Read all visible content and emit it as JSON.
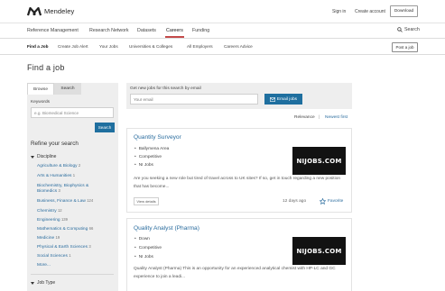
{
  "header": {
    "brand": "Mendeley",
    "sign_in": "Sign in",
    "create_account": "Create account",
    "download": "Download"
  },
  "nav_primary": {
    "items": [
      "Reference Management",
      "Research Network",
      "Datasets",
      "Careers",
      "Funding"
    ],
    "active": "Careers",
    "search": "Search"
  },
  "nav_secondary": {
    "items": [
      "Find a Job",
      "Create Job Alert",
      "Your Jobs",
      "Universities & Colleges",
      "All Employers",
      "Careers Advice"
    ],
    "active": "Find a Job",
    "post_job": "Post a job"
  },
  "page": {
    "title": "Find a job"
  },
  "left_panel": {
    "tabs": [
      "Browse",
      "Search"
    ],
    "keywords_label": "Keywords",
    "keywords_placeholder": "e.g. Biomedical Science",
    "search_button": "Search",
    "refine_title": "Refine your search",
    "discipline_label": "Discipline",
    "disciplines": [
      {
        "label": "Agriculture & Biology",
        "count": "2"
      },
      {
        "label": "Arts & Humanities",
        "count": "1"
      },
      {
        "label": "Biochemistry, Biophysics &",
        "count": ""
      },
      {
        "label": "Biomedics",
        "count": "3"
      },
      {
        "label": "Business, Finance & Law",
        "count": "124"
      },
      {
        "label": "Chemistry",
        "count": "12"
      },
      {
        "label": "Engineering",
        "count": "139"
      },
      {
        "label": "Mathematics & Computing",
        "count": "66"
      },
      {
        "label": "Medicine",
        "count": "19"
      },
      {
        "label": "Physical & Earth Sciences",
        "count": "3"
      },
      {
        "label": "Social Sciences",
        "count": "1"
      }
    ],
    "more": "More...",
    "job_type_label": "Job Type"
  },
  "email_alert": {
    "label": "Get new jobs for this search by email",
    "placeholder": "Your email",
    "button": "Email jobs"
  },
  "sort": {
    "relevance": "Relevance",
    "separator": "|",
    "newest": "Newest first"
  },
  "jobs": [
    {
      "title": "Quantity Surveyor",
      "bullets": [
        "Ballymena Area",
        "Competitive",
        "NI Jobs"
      ],
      "description": "Are you seeking a new role but tired of travel across to UK sites? If so, get in touch regarding a new position that has become...",
      "view": "View details",
      "posted": "12 days ago",
      "favorite": "Favorite",
      "logo_text": "NIJOBS.COM"
    },
    {
      "title": "Quality Analyst (Pharma)",
      "bullets": [
        "Down",
        "Competitive",
        "NI Jobs"
      ],
      "description": "Quality Analyst (Pharma) This is an opportunity for an experienced analytical chemist with HP-LC and GC experience to join a leadi...",
      "logo_text": "NIJOBS.COM"
    }
  ],
  "colors": {
    "accent": "#1f6f9f",
    "link": "#2a6c9e",
    "active_underline": "#c44a4a",
    "panel_bg": "#eeeeee"
  }
}
